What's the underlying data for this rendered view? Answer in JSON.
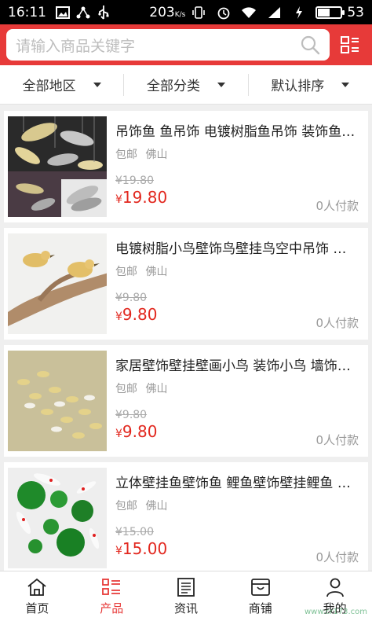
{
  "status_bar": {
    "time": "16:11",
    "speed_value": "203",
    "speed_unit": "K/s",
    "battery": "53",
    "battery_level": 0.53
  },
  "search": {
    "placeholder": "请输入商品关键字"
  },
  "filters": [
    {
      "label": "全部地区"
    },
    {
      "label": "全部分类"
    },
    {
      "label": "默认排序"
    }
  ],
  "products": [
    {
      "title": "吊饰鱼 鱼吊饰 电镀树脂鱼吊饰 装饰鱼吊饰",
      "tag": "包邮",
      "location": "佛山",
      "old_price": "¥19.80",
      "currency": "¥",
      "price": "19.80",
      "sold": "0人付款"
    },
    {
      "title": "电镀树脂小鸟壁饰鸟壁挂鸟空中吊饰 树脂",
      "tag": "包邮",
      "location": "佛山",
      "old_price": "¥9.80",
      "currency": "¥",
      "price": "9.80",
      "sold": "0人付款"
    },
    {
      "title": "家居壁饰壁挂壁画小鸟 装饰小鸟 墙饰小鸟",
      "tag": "包邮",
      "location": "佛山",
      "old_price": "¥9.80",
      "currency": "¥",
      "price": "9.80",
      "sold": "0人付款"
    },
    {
      "title": "立体壁挂鱼壁饰鱼 鲤鱼壁饰壁挂鲤鱼 荷叶",
      "tag": "包邮",
      "location": "佛山",
      "old_price": "¥15.00",
      "currency": "¥",
      "price": "15.00",
      "sold": "0人付款"
    }
  ],
  "bottom_nav": [
    {
      "label": "首页",
      "icon": "home-icon"
    },
    {
      "label": "产品",
      "icon": "list-icon"
    },
    {
      "label": "资讯",
      "icon": "news-icon"
    },
    {
      "label": "商铺",
      "icon": "shop-icon"
    },
    {
      "label": "我的",
      "icon": "user-icon"
    }
  ],
  "watermark": "www.cr173.com",
  "colors": {
    "brand": "#e73a39",
    "price": "#e2281f"
  }
}
